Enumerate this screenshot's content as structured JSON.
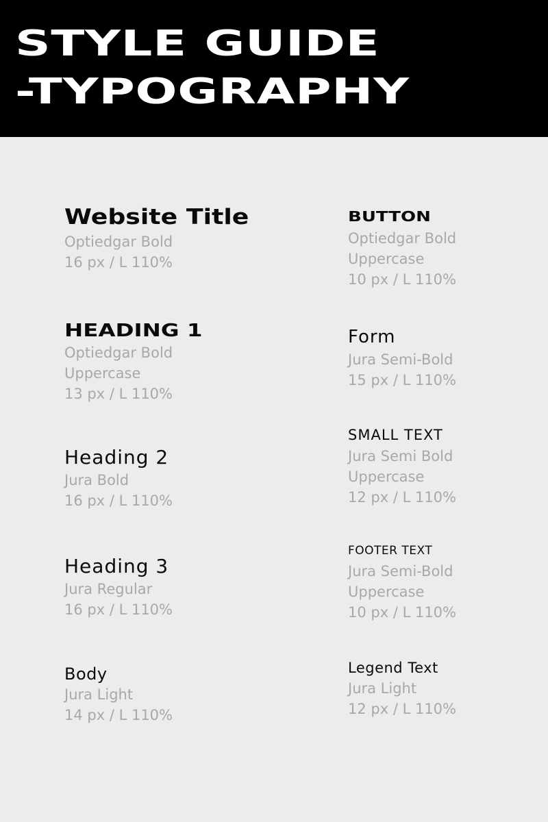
{
  "header": {
    "line1": "STYLE GUIDE",
    "line2": "-TYPOGRAPHY"
  },
  "left_column": [
    {
      "sample": "Website Title",
      "details": [
        "Optiedgar Bold",
        "16 px / L 110%"
      ]
    },
    {
      "sample": "HEADING 1",
      "details": [
        "Optiedgar Bold",
        "Uppercase",
        "13 px / L 110%"
      ]
    },
    {
      "sample": "Heading 2",
      "details": [
        "Jura Bold",
        "16 px / L 110%"
      ]
    },
    {
      "sample": "Heading 3",
      "details": [
        "Jura Regular",
        "16 px / L 110%"
      ]
    },
    {
      "sample": "Body",
      "details": [
        "Jura Light",
        "14 px / L 110%"
      ]
    }
  ],
  "right_column": [
    {
      "sample": "BUTTON",
      "details": [
        "Optiedgar Bold",
        "Uppercase",
        "10 px / L 110%"
      ]
    },
    {
      "sample": "Form",
      "details": [
        "Jura Semi-Bold",
        "15 px / L 110%"
      ]
    },
    {
      "sample": "SMALL TEXT",
      "details": [
        "Jura Semi Bold",
        "Uppercase",
        "12 px / L 110%"
      ]
    },
    {
      "sample": "FOOTER TEXT",
      "details": [
        "Jura Semi-Bold",
        "Uppercase",
        "10 px / L 110%"
      ]
    },
    {
      "sample": "Legend Text",
      "details": [
        "Jura Light",
        "12 px / L 110%"
      ]
    }
  ],
  "colors": {
    "header_bg": "#000000",
    "page_bg": "#ececec",
    "sample_text": "#0a0a0a",
    "detail_text": "#a8a8a8"
  }
}
